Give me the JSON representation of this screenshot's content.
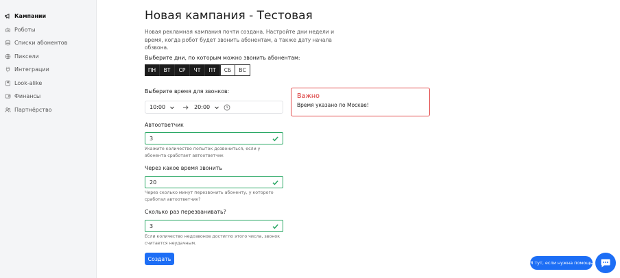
{
  "sidebar": {
    "items": [
      {
        "label": "Кампании",
        "icon": "megaphone-icon",
        "active": true
      },
      {
        "label": "Роботы",
        "icon": "robot-icon"
      },
      {
        "label": "Списки абонентов",
        "icon": "database-icon"
      },
      {
        "label": "Пиксели",
        "icon": "globe-icon"
      },
      {
        "label": "Интеграции",
        "icon": "plug-icon"
      },
      {
        "label": "Look-alike",
        "icon": "bookmark-icon"
      },
      {
        "label": "Финансы",
        "icon": "wallet-icon"
      },
      {
        "label": "Партнёрство",
        "icon": "users-icon"
      }
    ]
  },
  "main": {
    "title": "Новая кампания - Тестовая",
    "description": "Новая рекламная кампания почти создана. Настройте дни недели и время, когда робот будет звонить абонентам, а также дату начала обзвона.",
    "days_label": "Выберите дни, по которым можно звонить абонентам:",
    "days": [
      {
        "label": "ПН",
        "selected": true
      },
      {
        "label": "ВТ",
        "selected": true
      },
      {
        "label": "СР",
        "selected": true
      },
      {
        "label": "ЧТ",
        "selected": true
      },
      {
        "label": "ПТ",
        "selected": true
      },
      {
        "label": "СБ",
        "selected": false
      },
      {
        "label": "ВС",
        "selected": false
      }
    ],
    "time_label": "Выберите время для звонков:",
    "time_from": "10:00",
    "time_to": "20:00",
    "answering_machine": {
      "label": "Автоответчик",
      "value": "3",
      "hint": "Укажите количество попыток дозвониться, если у абонента сработает автоответчик"
    },
    "call_delay": {
      "label": "Через какое время звонить",
      "value": "20",
      "hint": "Через сколько минут перезвонить абоненту, у которого сработал автоответчик?"
    },
    "redial_count": {
      "label": "Сколько раз перезванивать?",
      "value": "3",
      "hint": "Если количество недозвонов достигло этого числа, звонок считается неудачным."
    },
    "create_button": "Создать"
  },
  "notice": {
    "title": "Важно",
    "text": "Время указано по Москве!"
  },
  "help": {
    "label": "Я тут, если нужна помощь"
  },
  "colors": {
    "accent": "#1d6ef5",
    "success": "#2aa865",
    "danger": "#e24a4a",
    "dark": "#1c1c1c"
  }
}
